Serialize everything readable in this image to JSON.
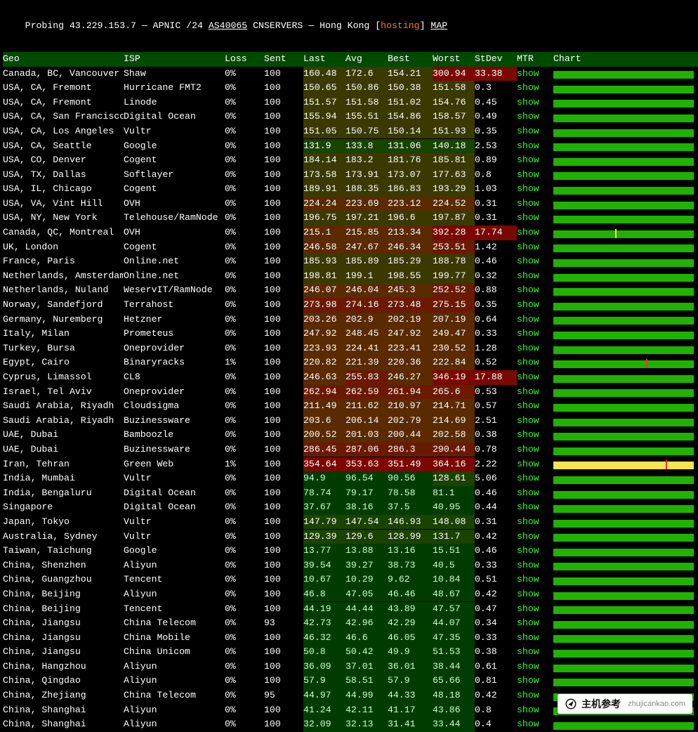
{
  "header": {
    "prefix": "Probing ",
    "ip": "43.229.153.7",
    "sep1": " — APNIC /24 ",
    "asn": "AS40065",
    "asn_label": " CNSERVERS — Hong Kong [",
    "hosting": "hosting",
    "sep2": "] ",
    "map": "MAP"
  },
  "columns": [
    "Geo",
    "ISP",
    "Loss",
    "Sent",
    "Last",
    "Avg",
    "Best",
    "Worst",
    "StDev",
    "MTR",
    "Chart"
  ],
  "mtr_label": "show",
  "rows": [
    {
      "geo": "Canada, BC, Vancouver",
      "isp": "Shaw",
      "loss": "0%",
      "sent": "100",
      "last": "160.48",
      "avg": "172.6",
      "best": "154.21",
      "worst": "300.94",
      "stdev": "33.38",
      "worst_hi": true,
      "st_hi": true
    },
    {
      "geo": "USA, CA, Fremont",
      "isp": "Hurricane FMT2",
      "loss": "0%",
      "sent": "100",
      "last": "150.65",
      "avg": "150.86",
      "best": "150.38",
      "worst": "151.58",
      "stdev": "0.3"
    },
    {
      "geo": "USA, CA, Fremont",
      "isp": "Linode",
      "loss": "0%",
      "sent": "100",
      "last": "151.57",
      "avg": "151.58",
      "best": "151.02",
      "worst": "154.76",
      "stdev": "0.45"
    },
    {
      "geo": "USA, CA, San Francisco",
      "isp": "Digital Ocean",
      "loss": "0%",
      "sent": "100",
      "last": "155.94",
      "avg": "155.51",
      "best": "154.86",
      "worst": "158.57",
      "stdev": "0.49"
    },
    {
      "geo": "USA, CA, Los Angeles",
      "isp": "Vultr",
      "loss": "0%",
      "sent": "100",
      "last": "151.05",
      "avg": "150.75",
      "best": "150.14",
      "worst": "151.93",
      "stdev": "0.35"
    },
    {
      "geo": "USA, CA, Seattle",
      "isp": "Google",
      "loss": "0%",
      "sent": "100",
      "last": "131.9",
      "avg": "133.8",
      "best": "131.06",
      "worst": "140.18",
      "stdev": "2.53"
    },
    {
      "geo": "USA, CO, Denver",
      "isp": "Cogent",
      "loss": "0%",
      "sent": "100",
      "last": "184.14",
      "avg": "183.2",
      "best": "181.76",
      "worst": "185.81",
      "stdev": "0.89"
    },
    {
      "geo": "USA, TX, Dallas",
      "isp": "Softlayer",
      "loss": "0%",
      "sent": "100",
      "last": "173.58",
      "avg": "173.91",
      "best": "173.07",
      "worst": "177.63",
      "stdev": "0.8"
    },
    {
      "geo": "USA, IL, Chicago",
      "isp": "Cogent",
      "loss": "0%",
      "sent": "100",
      "last": "189.91",
      "avg": "188.35",
      "best": "186.83",
      "worst": "193.29",
      "stdev": "1.03"
    },
    {
      "geo": "USA, VA, Vint Hill",
      "isp": "OVH",
      "loss": "0%",
      "sent": "100",
      "last": "224.24",
      "avg": "223.69",
      "best": "223.12",
      "worst": "224.52",
      "stdev": "0.31"
    },
    {
      "geo": "USA, NY, New York",
      "isp": "Telehouse/RamNode",
      "loss": "0%",
      "sent": "100",
      "last": "196.75",
      "avg": "197.21",
      "best": "196.6",
      "worst": "197.87",
      "stdev": "0.31"
    },
    {
      "geo": "Canada, QC, Montreal",
      "isp": "OVH",
      "loss": "0%",
      "sent": "100",
      "last": "215.1",
      "avg": "215.85",
      "best": "213.34",
      "worst": "392.28",
      "stdev": "17.74",
      "worst_hi": true,
      "st_hi": true,
      "mark": 44
    },
    {
      "geo": "UK, London",
      "isp": "Cogent",
      "loss": "0%",
      "sent": "100",
      "last": "246.58",
      "avg": "247.67",
      "best": "246.34",
      "worst": "253.51",
      "stdev": "1.42"
    },
    {
      "geo": "France, Paris",
      "isp": "Online.net",
      "loss": "0%",
      "sent": "100",
      "last": "185.93",
      "avg": "185.89",
      "best": "185.29",
      "worst": "188.78",
      "stdev": "0.46"
    },
    {
      "geo": "Netherlands, Amsterdam",
      "isp": "Online.net",
      "loss": "0%",
      "sent": "100",
      "last": "198.81",
      "avg": "199.1",
      "best": "198.55",
      "worst": "199.77",
      "stdev": "0.32"
    },
    {
      "geo": "Netherlands, Nuland",
      "isp": "WeservIT/RamNode",
      "loss": "0%",
      "sent": "100",
      "last": "246.07",
      "avg": "246.04",
      "best": "245.3",
      "worst": "252.52",
      "stdev": "0.88"
    },
    {
      "geo": "Norway, Sandefjord",
      "isp": "Terrahost",
      "loss": "0%",
      "sent": "100",
      "last": "273.98",
      "avg": "274.16",
      "best": "273.48",
      "worst": "275.15",
      "stdev": "0.35"
    },
    {
      "geo": "Germany, Nuremberg",
      "isp": "Hetzner",
      "loss": "0%",
      "sent": "100",
      "last": "203.26",
      "avg": "202.9",
      "best": "202.19",
      "worst": "207.19",
      "stdev": "0.64"
    },
    {
      "geo": "Italy, Milan",
      "isp": "Prometeus",
      "loss": "0%",
      "sent": "100",
      "last": "247.92",
      "avg": "248.45",
      "best": "247.92",
      "worst": "249.47",
      "stdev": "0.33"
    },
    {
      "geo": "Turkey, Bursa",
      "isp": "Oneprovider",
      "loss": "0%",
      "sent": "100",
      "last": "223.93",
      "avg": "224.41",
      "best": "223.41",
      "worst": "230.52",
      "stdev": "1.28"
    },
    {
      "geo": "Egypt, Cairo",
      "isp": "Binaryracks",
      "loss": "1%",
      "sent": "100",
      "last": "220.82",
      "avg": "221.39",
      "best": "220.36",
      "worst": "222.84",
      "stdev": "0.52",
      "mark": 66,
      "markred": true
    },
    {
      "geo": "Cyprus, Limassol",
      "isp": "CL8",
      "loss": "0%",
      "sent": "100",
      "last": "246.63",
      "avg": "255.83",
      "best": "246.27",
      "worst": "346.19",
      "stdev": "17.88",
      "worst_hi": true,
      "st_hi": true
    },
    {
      "geo": "Israel, Tel Aviv",
      "isp": "Oneprovider",
      "loss": "0%",
      "sent": "100",
      "last": "262.94",
      "avg": "262.59",
      "best": "261.94",
      "worst": "265.6",
      "stdev": "0.53"
    },
    {
      "geo": "Saudi Arabia, Riyadh",
      "isp": "Cloudsigma",
      "loss": "0%",
      "sent": "100",
      "last": "211.49",
      "avg": "211.62",
      "best": "210.97",
      "worst": "214.71",
      "stdev": "0.57"
    },
    {
      "geo": "Saudi Arabia, Riyadh",
      "isp": "Buzinessware",
      "loss": "0%",
      "sent": "100",
      "last": "203.6",
      "avg": "206.14",
      "best": "202.79",
      "worst": "214.69",
      "stdev": "2.51"
    },
    {
      "geo": "UAE, Dubai",
      "isp": "Bamboozle",
      "loss": "0%",
      "sent": "100",
      "last": "200.52",
      "avg": "201.03",
      "best": "200.44",
      "worst": "202.58",
      "stdev": "0.38"
    },
    {
      "geo": "UAE, Dubai",
      "isp": "Buzinessware",
      "loss": "0%",
      "sent": "100",
      "last": "286.45",
      "avg": "287.06",
      "best": "286.3",
      "worst": "290.44",
      "stdev": "0.78"
    },
    {
      "geo": "Iran, Tehran",
      "isp": "Green Web",
      "loss": "1%",
      "sent": "100",
      "last": "354.64",
      "avg": "353.63",
      "best": "351.49",
      "worst": "364.16",
      "stdev": "2.22",
      "worst_hi": true,
      "yellow": true,
      "mark": 80,
      "markred": true
    },
    {
      "geo": "India, Mumbai",
      "isp": "Vultr",
      "loss": "0%",
      "sent": "100",
      "last": "94.9",
      "avg": "96.54",
      "best": "90.56",
      "worst": "128.61",
      "stdev": "5.06"
    },
    {
      "geo": "India, Bengaluru",
      "isp": "Digital Ocean",
      "loss": "0%",
      "sent": "100",
      "last": "78.74",
      "avg": "79.17",
      "best": "78.58",
      "worst": "81.1",
      "stdev": "0.46"
    },
    {
      "geo": "Singapore",
      "isp": "Digital Ocean",
      "loss": "0%",
      "sent": "100",
      "last": "37.67",
      "avg": "38.16",
      "best": "37.5",
      "worst": "40.95",
      "stdev": "0.44"
    },
    {
      "geo": "Japan, Tokyo",
      "isp": "Vultr",
      "loss": "0%",
      "sent": "100",
      "last": "147.79",
      "avg": "147.54",
      "best": "146.93",
      "worst": "148.08",
      "stdev": "0.31"
    },
    {
      "geo": "Australia, Sydney",
      "isp": "Vultr",
      "loss": "0%",
      "sent": "100",
      "last": "129.39",
      "avg": "129.6",
      "best": "128.99",
      "worst": "131.7",
      "stdev": "0.42"
    },
    {
      "geo": "Taiwan, Taichung",
      "isp": "Google",
      "loss": "0%",
      "sent": "100",
      "last": "13.77",
      "avg": "13.88",
      "best": "13.16",
      "worst": "15.51",
      "stdev": "0.46"
    },
    {
      "geo": "China, Shenzhen",
      "isp": "Aliyun",
      "loss": "0%",
      "sent": "100",
      "last": "39.54",
      "avg": "39.27",
      "best": "38.73",
      "worst": "40.5",
      "stdev": "0.33"
    },
    {
      "geo": "China, Guangzhou",
      "isp": "Tencent",
      "loss": "0%",
      "sent": "100",
      "last": "10.67",
      "avg": "10.29",
      "best": "9.62",
      "worst": "10.84",
      "stdev": "0.51"
    },
    {
      "geo": "China, Beijing",
      "isp": "Aliyun",
      "loss": "0%",
      "sent": "100",
      "last": "46.8",
      "avg": "47.05",
      "best": "46.46",
      "worst": "48.67",
      "stdev": "0.42"
    },
    {
      "geo": "China, Beijing",
      "isp": "Tencent",
      "loss": "0%",
      "sent": "100",
      "last": "44.19",
      "avg": "44.44",
      "best": "43.89",
      "worst": "47.57",
      "stdev": "0.47"
    },
    {
      "geo": "China, Jiangsu",
      "isp": "China Telecom",
      "loss": "0%",
      "sent": "93",
      "last": "42.73",
      "avg": "42.96",
      "best": "42.29",
      "worst": "44.07",
      "stdev": "0.34"
    },
    {
      "geo": "China, Jiangsu",
      "isp": "China Mobile",
      "loss": "0%",
      "sent": "100",
      "last": "46.32",
      "avg": "46.6",
      "best": "46.05",
      "worst": "47.35",
      "stdev": "0.33"
    },
    {
      "geo": "China, Jiangsu",
      "isp": "China Unicom",
      "loss": "0%",
      "sent": "100",
      "last": "50.8",
      "avg": "50.42",
      "best": "49.9",
      "worst": "51.53",
      "stdev": "0.38"
    },
    {
      "geo": "China, Hangzhou",
      "isp": "Aliyun",
      "loss": "0%",
      "sent": "100",
      "last": "36.09",
      "avg": "37.01",
      "best": "36.01",
      "worst": "38.44",
      "stdev": "0.61"
    },
    {
      "geo": "China, Qingdao",
      "isp": "Aliyun",
      "loss": "0%",
      "sent": "100",
      "last": "57.9",
      "avg": "58.51",
      "best": "57.9",
      "worst": "65.66",
      "stdev": "0.81"
    },
    {
      "geo": "China, Zhejiang",
      "isp": "China Telecom",
      "loss": "0%",
      "sent": "95",
      "last": "44.97",
      "avg": "44.99",
      "best": "44.33",
      "worst": "48.18",
      "stdev": "0.42"
    },
    {
      "geo": "China, Shanghai",
      "isp": "Aliyun",
      "loss": "0%",
      "sent": "100",
      "last": "41.24",
      "avg": "42.11",
      "best": "41.17",
      "worst": "43.86",
      "stdev": "0.8"
    },
    {
      "geo": "China, Shanghai",
      "isp": "Aliyun",
      "loss": "0%",
      "sent": "100",
      "last": "32.09",
      "avg": "32.13",
      "best": "31.41",
      "worst": "33.44",
      "stdev": "0.4"
    }
  ],
  "watermark": {
    "brand": "主机参考",
    "url": "zhujicankao.com"
  }
}
